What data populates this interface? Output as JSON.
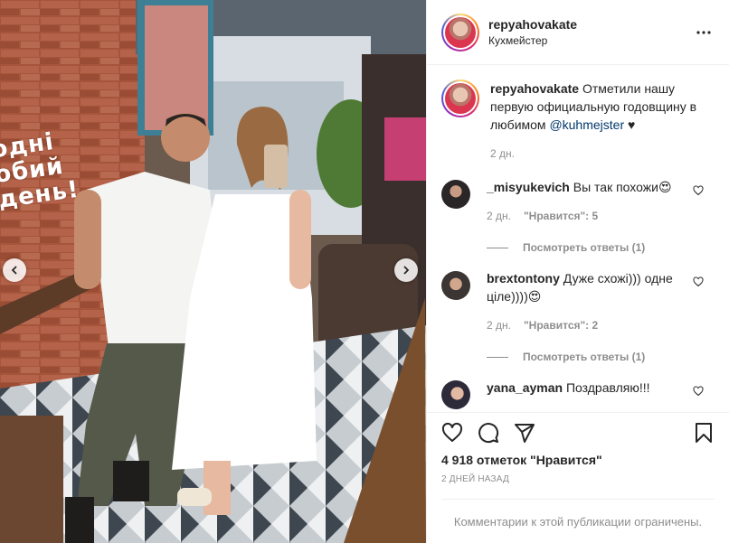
{
  "header": {
    "username": "repyahovakate",
    "location": "Кухмейстер"
  },
  "photo": {
    "wall_text": "одні\nобий\nдень!"
  },
  "caption": {
    "username": "repyahovakate",
    "text": "Отметили нашу первую официальную годовщину в любимом ",
    "mention": "@kuhmejster",
    "emoji": "♥",
    "time": "2 дн."
  },
  "comments": [
    {
      "username": "_misyukevich",
      "text": "Вы так похожи😍",
      "time": "2 дн.",
      "likes": "\"Нравится\": 5",
      "replies": "Посмотреть ответы (1)"
    },
    {
      "username": "brextontony",
      "text": "Дуже схожі))) одне ціле))))😍",
      "time": "2 дн.",
      "likes": "\"Нравится\": 2",
      "replies": "Посмотреть ответы (1)"
    },
    {
      "username": "yana_ayman",
      "text": "Поздравляю!!!"
    }
  ],
  "actions": {
    "like_count": "4 918 отметок \"Нравится\"",
    "date": "2 ДНЕЙ НАЗАД"
  },
  "footer": {
    "restricted": "Комментарии к этой публикации ограничены."
  },
  "colors": {
    "link": "#00376b",
    "secondary": "#8e8e8e"
  }
}
